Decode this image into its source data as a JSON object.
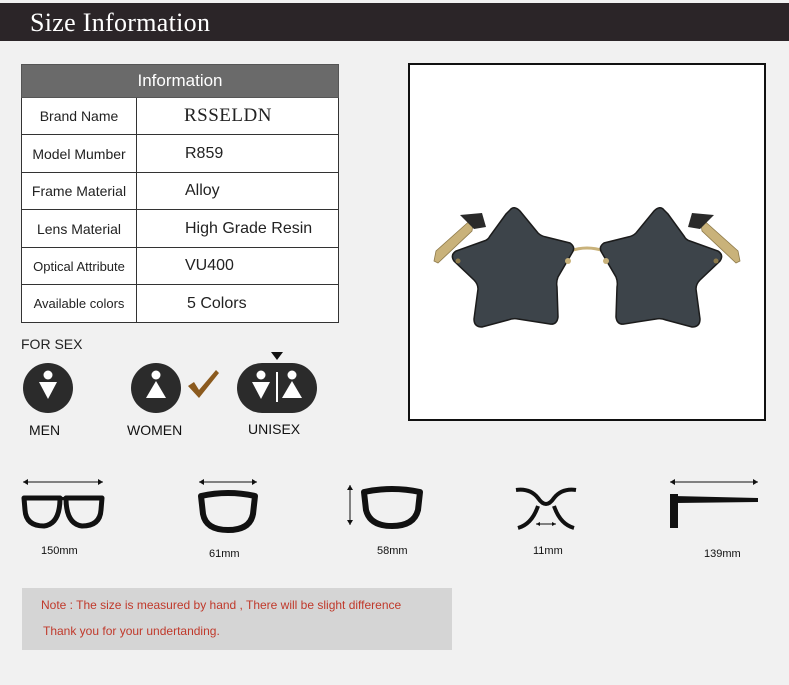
{
  "header": {
    "title": "Size Information"
  },
  "info": {
    "heading": "Information",
    "rows": [
      {
        "key": "Brand Name",
        "value": "RSSELDN"
      },
      {
        "key": "Model Mumber",
        "value": "R859"
      },
      {
        "key": "Frame Material",
        "value": "Alloy"
      },
      {
        "key": "Lens Material",
        "value": "High Grade Resin"
      },
      {
        "key": "Optical Attribute",
        "value": "VU400"
      },
      {
        "key": "Available colors",
        "value": "5 Colors"
      }
    ]
  },
  "sex": {
    "title": "FOR SEX",
    "men": "MEN",
    "women": "WOMEN",
    "unisex": "UNISEX",
    "selected": "WOMEN",
    "check_color": "#8b5a1e"
  },
  "measurements": [
    {
      "label": "150mm"
    },
    {
      "label": "61mm"
    },
    {
      "label": "58mm"
    },
    {
      "label": "11mm"
    },
    {
      "label": "139mm"
    }
  ],
  "note": {
    "line1": "Note : The size is measured by hand , There will be slight difference",
    "line2": "Thank you for your undertanding."
  },
  "colors": {
    "header_bg": "#2b2528",
    "lens": "#3d444a",
    "frame": "#c9b27a"
  }
}
